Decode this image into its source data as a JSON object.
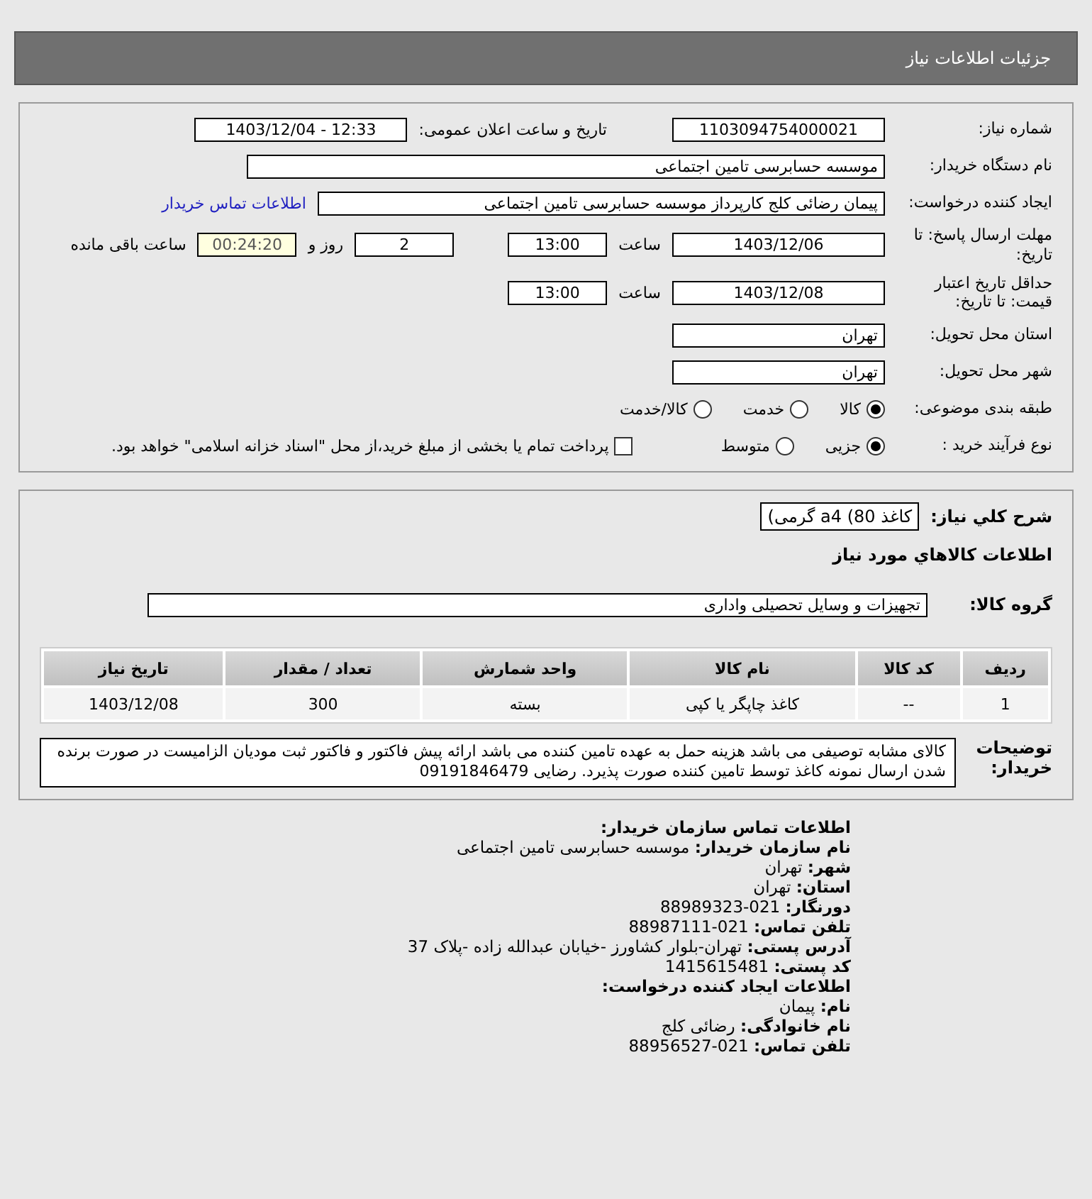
{
  "header": {
    "title": "جزئیات اطلاعات نیاز"
  },
  "form": {
    "need_number": {
      "label": "شماره نیاز:",
      "value": "1103094754000021"
    },
    "announce": {
      "label": "تاریخ و ساعت اعلان عمومی:",
      "value": "1403/12/04 - 12:33"
    },
    "buyer_org": {
      "label": "نام دستگاه خریدار:",
      "value": "موسسه حسابرسی تامین اجتماعی"
    },
    "requester": {
      "label": "ایجاد کننده درخواست:",
      "value": "پیمان رضائی کلج کارپرداز موسسه حسابرسی تامین اجتماعی",
      "link": "اطلاعات تماس خریدار"
    },
    "deadline": {
      "label": "مهلت ارسال پاسخ: تا تاریخ:",
      "date": "1403/12/06",
      "time_label": "ساعت",
      "time": "13:00",
      "days": "2",
      "days_label": "روز و",
      "remaining": "00:24:20",
      "remaining_label": "ساعت باقی مانده"
    },
    "validity": {
      "label": "حداقل تاریخ اعتبار قیمت: تا تاریخ:",
      "date": "1403/12/08",
      "time_label": "ساعت",
      "time": "13:00"
    },
    "province": {
      "label": "استان محل تحویل:",
      "value": "تهران"
    },
    "city": {
      "label": "شهر محل تحویل:",
      "value": "تهران"
    },
    "category": {
      "label": "طبقه بندی موضوعی:",
      "options": [
        {
          "label": "کالا",
          "selected": true
        },
        {
          "label": "خدمت",
          "selected": false
        },
        {
          "label": "کالا/خدمت",
          "selected": false
        }
      ]
    },
    "process": {
      "label": "نوع فرآیند خرید :",
      "options": [
        {
          "label": "جزیی",
          "selected": true
        },
        {
          "label": "متوسط",
          "selected": false
        }
      ],
      "checkbox": {
        "label": "پرداخت تمام یا بخشی از مبلغ خرید،از محل \"اسناد خزانه اسلامی\" خواهد بود.",
        "checked": false
      }
    }
  },
  "details": {
    "summary": {
      "label": "شرح کلي نياز:",
      "value": "کاغذ 80) a4 گرمی)"
    },
    "goods_heading": "اطلاعات کالاهاي مورد نياز",
    "group": {
      "label": "گروه کالا:",
      "value": "تجهیزات و وسایل تحصیلی واداری"
    },
    "table": {
      "columns": [
        "ردیف",
        "کد کالا",
        "نام کالا",
        "واحد شمارش",
        "تعداد / مقدار",
        "تاریخ نیاز"
      ],
      "rows": [
        [
          "1",
          "--",
          "کاغذ چاپگر یا کپی",
          "بسته",
          "300",
          "1403/12/08"
        ]
      ]
    },
    "notes": {
      "label": "توضیحات خریدار:",
      "value": "کالای مشابه توصیفی می باشد هزینه حمل به عهده تامین کننده می باشد ارائه پیش فاکتور و فاکتور ثبت مودیان الزامیست در صورت برنده شدن ارسال نمونه کاغذ توسط تامین کننده صورت پذیرد. رضایی 09191846479"
    }
  },
  "contact": [
    {
      "kind": "heading",
      "label": "اطلاعات تماس سازمان خریدار:"
    },
    {
      "kind": "field",
      "label": "نام سازمان خریدار:",
      "value": "موسسه حسابرسی تامین اجتماعی"
    },
    {
      "kind": "field",
      "label": "شهر:",
      "value": "تهران"
    },
    {
      "kind": "field",
      "label": "استان:",
      "value": "تهران"
    },
    {
      "kind": "field",
      "label": "دورنگار:",
      "value": "88989323-021"
    },
    {
      "kind": "field",
      "label": "تلفن تماس:",
      "value": "88987111-021"
    },
    {
      "kind": "field",
      "label": "آدرس پستی:",
      "value": "تهران-بلوار کشاورز -خیابان عبدالله زاده -پلاک 37"
    },
    {
      "kind": "field",
      "label": "کد پستی:",
      "value": "1415615481"
    },
    {
      "kind": "heading",
      "label": "اطلاعات ایجاد کننده درخواست:"
    },
    {
      "kind": "field",
      "label": "نام:",
      "value": "پیمان"
    },
    {
      "kind": "field",
      "label": "نام خانوادگی:",
      "value": "رضائی کلج"
    },
    {
      "kind": "field",
      "label": "تلفن تماس:",
      "value": "88956527-021"
    }
  ]
}
